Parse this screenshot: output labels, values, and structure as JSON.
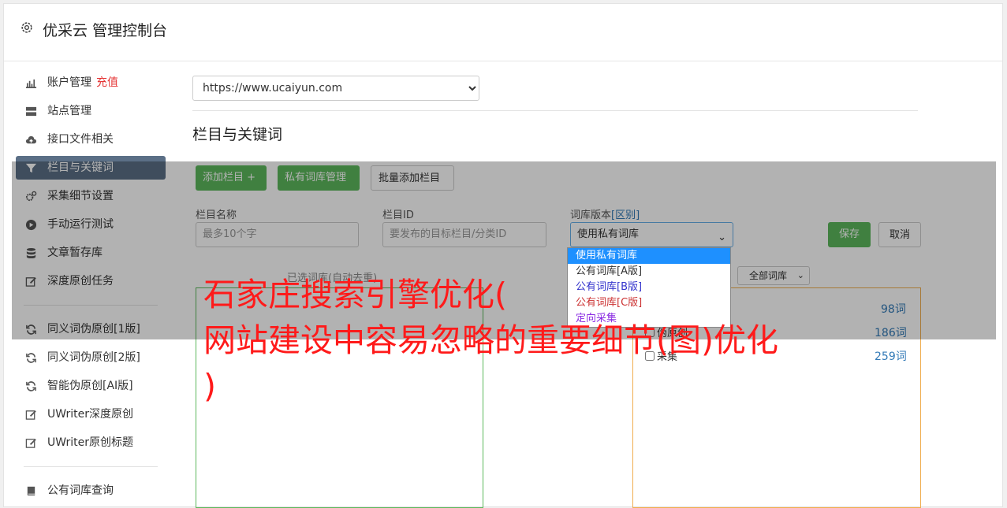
{
  "header": {
    "title": "优采云 管理控制台"
  },
  "sidebar": {
    "group1": [
      {
        "label": "账户管理",
        "extra": "充值",
        "icon": "bar-chart-icon"
      },
      {
        "label": "站点管理",
        "icon": "server-icon"
      },
      {
        "label": "接口文件相关",
        "icon": "cloud-upload-icon"
      },
      {
        "label": "栏目与关键词",
        "icon": "filter-icon",
        "active": true
      },
      {
        "label": "采集细节设置",
        "icon": "cogs-icon"
      },
      {
        "label": "手动运行测试",
        "icon": "play-circle-icon"
      },
      {
        "label": "文章暂存库",
        "icon": "database-icon"
      },
      {
        "label": "深度原创任务",
        "icon": "edit-icon"
      }
    ],
    "group2": [
      {
        "label": "同义词伪原创[1版]",
        "icon": "refresh-icon"
      },
      {
        "label": "同义词伪原创[2版]",
        "icon": "refresh-icon"
      },
      {
        "label": "智能伪原创[AI版]",
        "icon": "refresh-icon"
      },
      {
        "label": "UWriter深度原创",
        "icon": "edit-icon"
      },
      {
        "label": "UWriter原创标题",
        "icon": "edit-icon"
      }
    ],
    "group3": [
      {
        "label": "公有词库查询",
        "icon": "book-icon"
      }
    ]
  },
  "main": {
    "site_select": "https://www.ucaiyun.com",
    "section_title": "栏目与关键词",
    "buttons": {
      "add_column": "添加栏目 +",
      "private_lib": "私有词库管理",
      "batch_add": "批量添加栏目",
      "save": "保存",
      "cancel": "取消"
    },
    "form": {
      "name_label": "栏目名称",
      "name_placeholder": "最多10个字",
      "id_label": "栏目ID",
      "id_placeholder": "要发布的目标栏目/分类ID",
      "lib_label": "词库版本",
      "lib_label_link": "[区别]",
      "lib_selected": "使用私有词库"
    },
    "dropdown_options": [
      "使用私有词库",
      "公有词库[A版]",
      "公有词库[B版]",
      "公有词库[C版]",
      "定向采集"
    ],
    "selected_hint": "已选词库(自动去重)",
    "filter": "全部词库",
    "library_rows": [
      {
        "label": "",
        "count": "98词"
      },
      {
        "label": "伪原创",
        "count": "186词"
      },
      {
        "label": "采集",
        "count": "259词"
      }
    ]
  },
  "watermark": {
    "lines": [
      "石家庄搜索引擎优化(",
      "网站建设中容易忽略的重要细节(图)优化",
      ")"
    ]
  }
}
